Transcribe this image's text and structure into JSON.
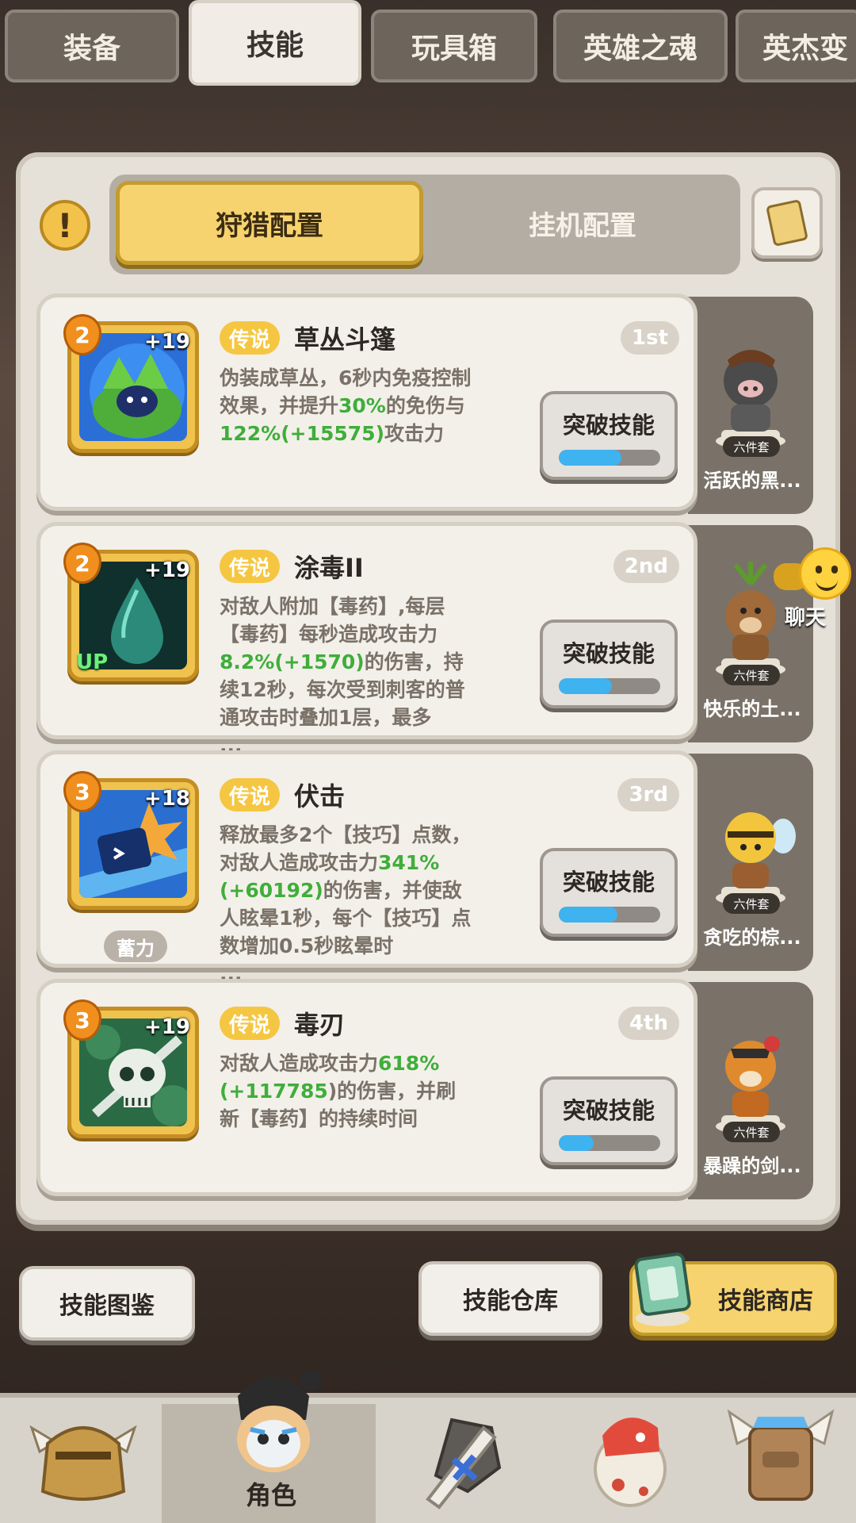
{
  "top_tabs": [
    "装备",
    "技能",
    "玩具箱",
    "英雄之魂",
    "英杰变"
  ],
  "config_tabs": {
    "hunt": "狩猎配置",
    "idle": "挂机配置"
  },
  "skills": [
    {
      "level": "2",
      "plus": "+19",
      "tag": "传说",
      "name": "草丛斗篷",
      "rank": "1st",
      "desc_parts": [
        "伪装成草丛，6秒内免疫控制效果，并提升",
        "30%",
        "的免伤与",
        "122%(+15575)",
        "攻击力"
      ],
      "button": "突破技能",
      "progress": 0.62,
      "set_badge": "六件套",
      "set_name": "活跃的黑..."
    },
    {
      "level": "2",
      "plus": "+19",
      "tag": "传说",
      "name": "涂毒II",
      "rank": "2nd",
      "up": "UP",
      "desc_parts": [
        "对敌人附加【毒药】,每层【毒药】每秒造成攻击力",
        "8.2%(+1570)",
        "的伤害，持续12秒，每次受到刺客的普通攻击时叠加1层，最多\n...",
        "",
        ""
      ],
      "button": "突破技能",
      "progress": 0.52,
      "set_badge": "六件套",
      "set_name": "快乐的土..."
    },
    {
      "level": "3",
      "plus": "+18",
      "tag": "传说",
      "name": "伏击",
      "rank": "3rd",
      "charge": "蓄力",
      "desc_parts": [
        "释放最多2个【技巧】点数，对敌人造成攻击力",
        "341%(+60192)",
        "的伤害，并使敌人眩晕1秒，每个【技巧】点数增加0.5秒眩晕时\n...",
        "",
        ""
      ],
      "button": "突破技能",
      "progress": 0.58,
      "set_badge": "六件套",
      "set_name": "贪吃的棕..."
    },
    {
      "level": "3",
      "plus": "+19",
      "tag": "传说",
      "name": "毒刃",
      "rank": "4th",
      "desc_parts": [
        "对敌人造成攻击力",
        "618%(+117785",
        ")的伤害，并刷新【毒药】的持续时间",
        "",
        ""
      ],
      "button": "突破技能",
      "progress": 0.34,
      "set_badge": "六件套",
      "set_name": "暴躁的剑..."
    }
  ],
  "chat_label": "聊天",
  "bottom_buttons": {
    "codex": "技能图鉴",
    "warehouse": "技能仓库",
    "shop": "技能商店"
  },
  "nav": {
    "active_label": "角色"
  },
  "icons": [
    "warning-icon",
    "scroll-hand-icon",
    "bush-cloak-icon",
    "poison-drop-icon",
    "ambush-icon",
    "poison-blade-skull-icon",
    "chat-emoji-icon",
    "skill-shop-icon"
  ]
}
